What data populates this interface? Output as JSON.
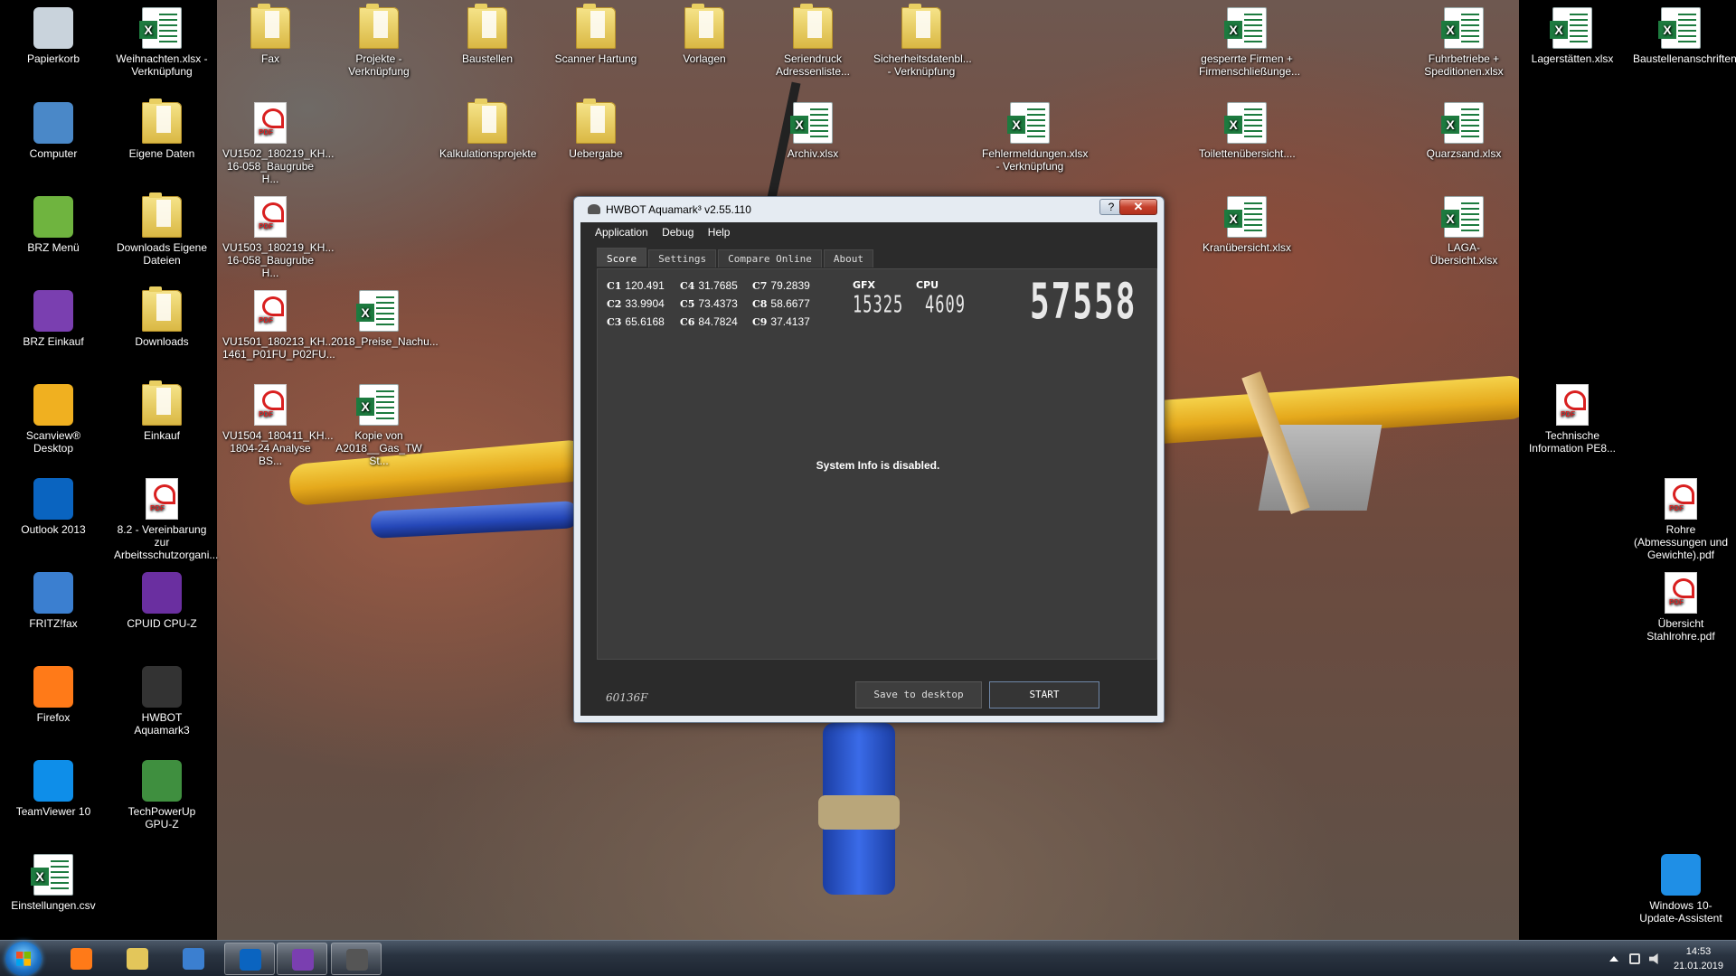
{
  "desktop": {
    "icons_left": [
      {
        "label": "Papierkorb",
        "icon": "recycle-bin-icon",
        "color": "#c9d3dc"
      },
      {
        "label": "Weihnachten.xlsx - Verknüpfung",
        "icon": "excel-file-icon",
        "color": "#1d7b3f"
      },
      {
        "label": "Computer",
        "icon": "computer-icon",
        "color": "#4a88c8"
      },
      {
        "label": "Eigene Daten",
        "icon": "user-folder-icon",
        "color": "#4e7a3a"
      },
      {
        "label": "BRZ Menü",
        "icon": "brz-menu-icon",
        "color": "#6fb43f"
      },
      {
        "label": "Downloads Eigene Dateien",
        "icon": "folder-icon",
        "color": "#e3c65a"
      },
      {
        "label": "BRZ Einkauf",
        "icon": "shopping-cart-icon",
        "color": "#7a3fb0"
      },
      {
        "label": "Downloads",
        "icon": "downloads-folder-icon",
        "color": "#e3c65a"
      },
      {
        "label": "Scanview® Desktop",
        "icon": "scanview-icon",
        "color": "#f0b020"
      },
      {
        "label": "Einkauf",
        "icon": "folder-icon",
        "color": "#e3c65a"
      },
      {
        "label": "Outlook 2013",
        "icon": "outlook-icon",
        "color": "#0a64c0"
      },
      {
        "label": "8.2 - Vereinbarung zur Arbeitsschutzorgani...",
        "icon": "pdf-file-icon",
        "color": "#d92020"
      },
      {
        "label": "FRITZ!fax",
        "icon": "fritzfax-icon",
        "color": "#3b7fd0"
      },
      {
        "label": "CPUID CPU-Z",
        "icon": "cpu-z-icon",
        "color": "#6a2fa0"
      },
      {
        "label": "Firefox",
        "icon": "firefox-icon",
        "color": "#ff7a18"
      },
      {
        "label": "HWBOT Aquamark3",
        "icon": "aquamark-icon",
        "color": "#333333"
      },
      {
        "label": "TeamViewer 10",
        "icon": "teamviewer-icon",
        "color": "#0e8ee9"
      },
      {
        "label": "TechPowerUp GPU-Z",
        "icon": "gpu-z-icon",
        "color": "#3f8f3f"
      },
      {
        "label": "Einstellungen.csv",
        "icon": "csv-file-icon",
        "color": "#1d7b3f"
      }
    ],
    "icons_main": [
      {
        "label": "Fax",
        "icon": "folder-icon",
        "kind": "folder"
      },
      {
        "label": "Projekte - Verknüpfung",
        "icon": "folder-icon",
        "kind": "folder"
      },
      {
        "label": "Baustellen",
        "icon": "folder-icon",
        "kind": "folder"
      },
      {
        "label": "Scanner Hartung",
        "icon": "folder-icon",
        "kind": "folder"
      },
      {
        "label": "Vorlagen",
        "icon": "folder-icon",
        "kind": "folder"
      },
      {
        "label": "Seriendruck Adressenliste...",
        "icon": "folder-icon",
        "kind": "folder"
      },
      {
        "label": "Sicherheitsdatenbl... - Verknüpfung",
        "icon": "folder-icon",
        "kind": "folder"
      },
      {
        "label": "gesperrte Firmen + Firmenschließunge...",
        "icon": "excel-file-icon",
        "kind": "xls"
      },
      {
        "label": "Fuhrbetriebe + Speditionen.xlsx",
        "icon": "excel-file-icon",
        "kind": "xls"
      },
      {
        "label": "Lagerstätten.xlsx",
        "icon": "excel-file-icon",
        "kind": "xls"
      },
      {
        "label": "Baustellenanschriften",
        "icon": "excel-file-icon",
        "kind": "xls"
      },
      {
        "label": "VU1502_180219_KH... 16-058_Baugrube H...",
        "icon": "pdf-file-icon",
        "kind": "pdf"
      },
      {
        "label": "Kalkulationsprojekte",
        "icon": "folder-icon",
        "kind": "folder"
      },
      {
        "label": "Uebergabe",
        "icon": "folder-icon",
        "kind": "folder"
      },
      {
        "label": "Archiv.xlsx",
        "icon": "excel-file-icon",
        "kind": "xls"
      },
      {
        "label": "Fehlermeldungen.xlsx - Verknüpfung",
        "icon": "excel-file-icon",
        "kind": "xls"
      },
      {
        "label": "Toilettenübersicht....",
        "icon": "excel-file-icon",
        "kind": "xls"
      },
      {
        "label": "Quarzsand.xlsx",
        "icon": "excel-file-icon",
        "kind": "xls"
      },
      {
        "label": "VU1503_180219_KH... 16-058_Baugrube H...",
        "icon": "pdf-file-icon",
        "kind": "pdf"
      },
      {
        "label": "Kranübersicht.xlsx",
        "icon": "excel-file-icon",
        "kind": "xls"
      },
      {
        "label": "LAGA-Übersicht.xlsx",
        "icon": "excel-file-icon",
        "kind": "xls"
      },
      {
        "label": "VU1501_180213_KH... 1461_P01FU_P02FU...",
        "icon": "pdf-file-icon",
        "kind": "pdf"
      },
      {
        "label": "2018_Preise_Nachu...",
        "icon": "excel-file-icon",
        "kind": "xls"
      },
      {
        "label": "VU1504_180411_KH... 1804-24 Analyse BS...",
        "icon": "pdf-file-icon",
        "kind": "pdf"
      },
      {
        "label": "Kopie von A2018__Gas_TW St...",
        "icon": "excel-file-icon",
        "kind": "xls"
      },
      {
        "label": "Technische Information PE8...",
        "icon": "pdf-file-icon",
        "kind": "pdf"
      },
      {
        "label": "Rohre (Abmessungen und Gewichte).pdf",
        "icon": "pdf-file-icon",
        "kind": "pdf"
      },
      {
        "label": "Übersicht Stahlrohre.pdf",
        "icon": "pdf-file-icon",
        "kind": "pdf"
      },
      {
        "label": "Windows 10-Update-Assistent",
        "icon": "windows-logo-icon",
        "kind": "win"
      }
    ]
  },
  "window": {
    "title": "HWBOT Aquamark³ v2.55.110",
    "help_button": "?",
    "close_button": "✕",
    "menu": [
      "Application",
      "Debug",
      "Help"
    ],
    "tabs": [
      "Score",
      "Settings",
      "Compare Online",
      "About"
    ],
    "active_tab": "Score",
    "scores": [
      {
        "label": "C1",
        "value": "120.491"
      },
      {
        "label": "C2",
        "value": "33.9904"
      },
      {
        "label": "C3",
        "value": "65.6168"
      },
      {
        "label": "C4",
        "value": "31.7685"
      },
      {
        "label": "C5",
        "value": "73.4373"
      },
      {
        "label": "C6",
        "value": "84.7824"
      },
      {
        "label": "C7",
        "value": "79.2839"
      },
      {
        "label": "C8",
        "value": "58.6677"
      },
      {
        "label": "C9",
        "value": "37.4137"
      }
    ],
    "gfx_label": "GFX",
    "gfx_value": "15325",
    "cpu_label": "CPU",
    "cpu_value": "4609",
    "total_score": "57558",
    "sysinfo_text": "System Info is disabled.",
    "code": "60136F",
    "save_button": "Save to desktop",
    "start_button": "START"
  },
  "taskbar": {
    "buttons": [
      {
        "name": "firefox-taskbar-button",
        "icon": "firefox-icon",
        "color": "#ff7a18"
      },
      {
        "name": "explorer-taskbar-button",
        "icon": "folder-icon",
        "color": "#e3c65a"
      },
      {
        "name": "fritzfax-taskbar-button",
        "icon": "fritzfax-icon",
        "color": "#3b7fd0"
      },
      {
        "name": "outlook-taskbar-button",
        "icon": "outlook-icon",
        "color": "#0a64c0"
      },
      {
        "name": "brz-einkauf-taskbar-button",
        "icon": "shopping-cart-icon",
        "color": "#7a3fb0"
      },
      {
        "name": "aquamark-taskbar-button",
        "icon": "aquamark-icon",
        "color": "#555555"
      }
    ],
    "time": "14:53",
    "date": "21.01.2019"
  },
  "colors": {
    "window_frame": "#e5ebf2",
    "app_bg": "#2b2b2b",
    "close_red": "#c4402c",
    "start_border": "#6f87a8"
  }
}
